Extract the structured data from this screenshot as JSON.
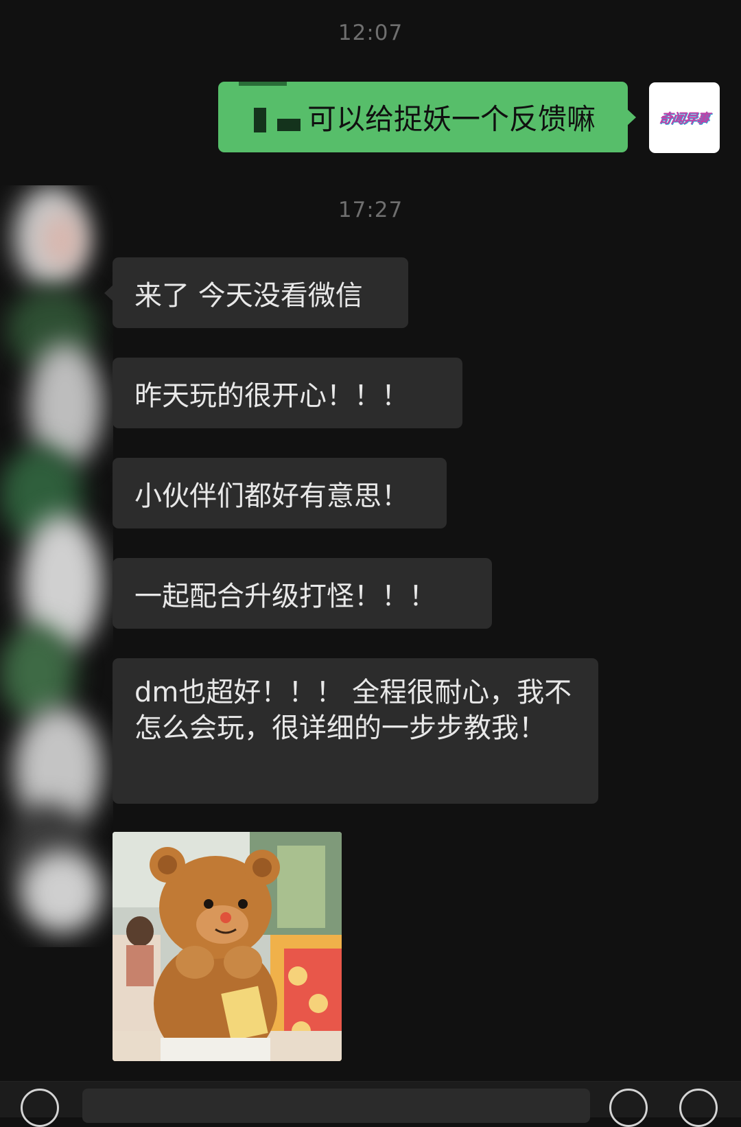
{
  "chat": {
    "timestamps": [
      "12:07",
      "17:27"
    ],
    "outgoing": [
      {
        "text": "可以给捉妖一个反馈嘛"
      }
    ],
    "incoming": [
      {
        "text": "来了 今天没看微信"
      },
      {
        "text": "昨天玩的很开心！！！"
      },
      {
        "text": "小伙伴们都好有意思！"
      },
      {
        "text": "一起配合升级打怪！！！"
      },
      {
        "text": "dm也超好！！！ 全程很耐心，我不怎么会玩，很详细的一步步教我！"
      }
    ],
    "image_message": {
      "kind": "photo",
      "subject": "plush-bear"
    }
  },
  "my_avatar": {
    "logo_text": "奇闻异事"
  },
  "colors": {
    "background": "#111111",
    "outgoing_bubble": "#57be6a",
    "incoming_bubble": "#2c2c2c",
    "timestamp": "#6f6f6f"
  },
  "icons": [
    "voice-icon",
    "emoji-icon",
    "plus-icon"
  ]
}
